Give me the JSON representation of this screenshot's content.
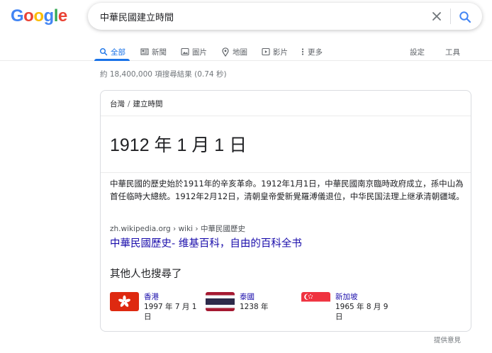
{
  "logo": {
    "letters": [
      "G",
      "o",
      "o",
      "g",
      "l",
      "e"
    ],
    "colors": [
      "#4285F4",
      "#EA4335",
      "#FBBC05",
      "#4285F4",
      "#34A853",
      "#EA4335"
    ]
  },
  "search": {
    "query": "中華民國建立時間"
  },
  "tabs": [
    {
      "label": "全部",
      "icon": "search-icon",
      "active": true
    },
    {
      "label": "新聞",
      "icon": "news-icon"
    },
    {
      "label": "圖片",
      "icon": "image-icon"
    },
    {
      "label": "地圖",
      "icon": "map-pin-icon"
    },
    {
      "label": "影片",
      "icon": "video-icon"
    },
    {
      "label": "更多",
      "icon": "more-icon"
    }
  ],
  "tools": {
    "settings": "設定",
    "tools": "工具"
  },
  "stats": "約 18,400,000 項搜尋結果 (0.74 秒)",
  "card": {
    "breadcrumb": {
      "parent": "台灣",
      "sep": "/",
      "current": "建立時間"
    },
    "answer": "1912 年 1 月 1 日",
    "description": "中華民國的歷史始於1911年的辛亥革命。1912年1月1日，中華民國南京臨時政府成立，孫中山為首任临時大總統。1912年2月12日，清朝皇帝愛新覺羅溥儀退位，中华民国法理上继承清朝疆域。",
    "cite": "zh.wikipedia.org › wiki › 中華民國歷史",
    "link_title": "中華民國歷史- 维基百科，自由的百科全书",
    "also_title": "其他人也搜尋了",
    "entities": [
      {
        "name": "香港",
        "date": "1997 年 7 月 1 日",
        "flag": "hong-kong-flag"
      },
      {
        "name": "泰國",
        "date": "1238 年",
        "flag": "thailand-flag"
      },
      {
        "name": "新加坡",
        "date": "1965 年 8 月 9 日",
        "flag": "singapore-flag"
      }
    ]
  },
  "feedback": "提供意見",
  "colors": {
    "accent": "#1a73e8",
    "link": "#1a0dab",
    "muted": "#70757a"
  }
}
